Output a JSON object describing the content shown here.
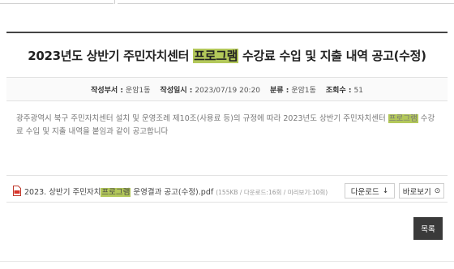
{
  "post": {
    "title_pre": "2023년도 상반기 주민자치센터 ",
    "title_hl": "프로그램",
    "title_post": " 수강료 수입 및 지출 내역 공고(수정)",
    "meta": {
      "author_label": "작성부서 :",
      "author_value": "운암1동",
      "date_label": "작성일시 :",
      "date_value": "2023/07/19 20:20",
      "category_label": "분류 :",
      "category_value": "운암1동",
      "views_label": "조회수 :",
      "views_value": "51"
    },
    "body_pre": "광주광역시 북구 주민자치센터 설치 및 운영조례 제10조(사용료 등)의 규정에 따라 2023년도 상반기 주민자치센터 ",
    "body_hl": "프로그램",
    "body_post": " 수강료 수입 및 지출 내역을 붙임과 같이 공고합니다"
  },
  "attachment": {
    "icon": "pdf-file-icon",
    "name_pre": "2023. 상반기 주민자치",
    "name_hl": "프로그램",
    "name_post": " 운영결과 공고(수정).pdf",
    "info": "(155KB / 다운로드:16회 / 미리보기:10회)",
    "download_label": "다운로드",
    "download_icon": "↓",
    "preview_label": "바로보기",
    "preview_icon": "⊙"
  },
  "list_button": "목록",
  "colors": {
    "highlight": "#b3c85a",
    "header_border": "#444444",
    "list_button_bg": "#3a3a3a"
  }
}
